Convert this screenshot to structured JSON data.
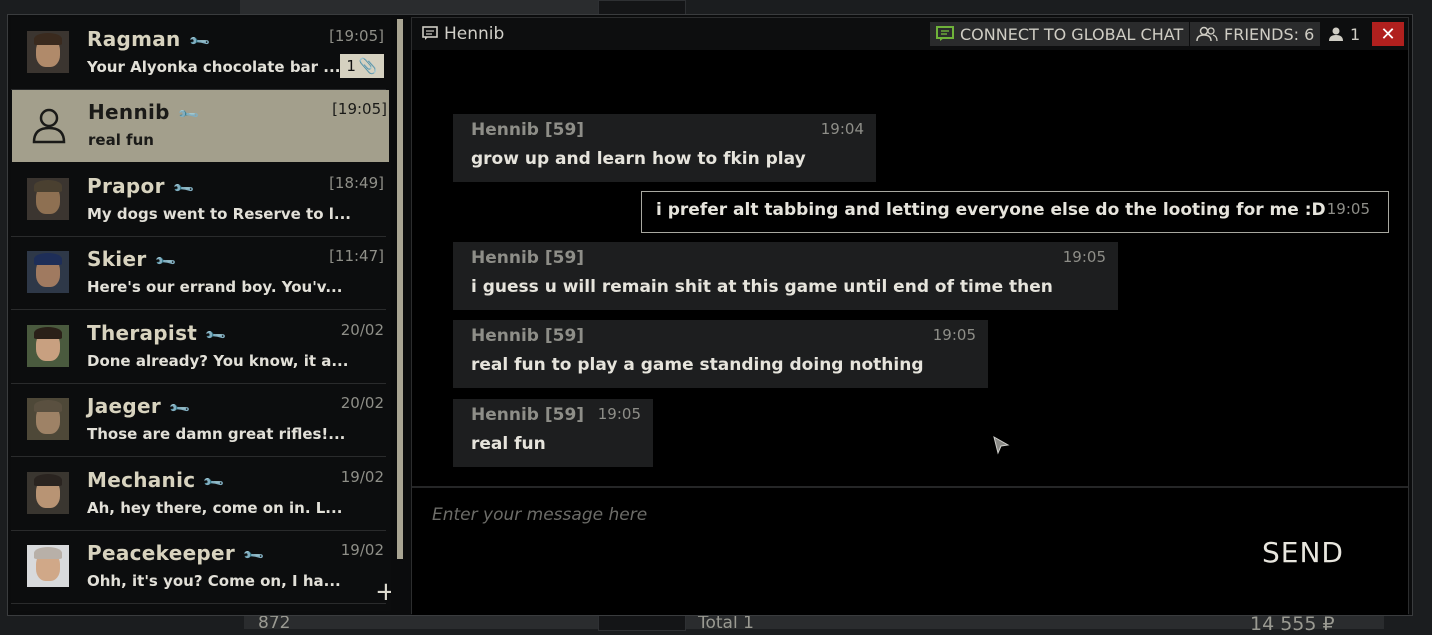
{
  "background": {
    "bottom_left_number": "872",
    "bottom_center_text": "Total 1",
    "bottom_right_number": "14 555 ₽"
  },
  "contacts": [
    {
      "name": "Ragman",
      "time": "[19:05]",
      "preview": "Your Alyonka chocolate bar  ...",
      "badge": "1",
      "active": false
    },
    {
      "name": "Hennib",
      "time": "[19:05]",
      "preview": "real fun",
      "active": true
    },
    {
      "name": "Prapor",
      "time": "[18:49]",
      "preview": "My dogs went to Reserve to l...",
      "active": false
    },
    {
      "name": "Skier",
      "time": "[11:47]",
      "preview": "Here's our errand boy. You'v...",
      "active": false
    },
    {
      "name": "Therapist",
      "time": "20/02",
      "preview": "Done already? You know, it a...",
      "active": false
    },
    {
      "name": "Jaeger",
      "time": "20/02",
      "preview": "Those are damn great rifles!...",
      "active": false
    },
    {
      "name": "Mechanic",
      "time": "19/02",
      "preview": "Ah, hey there, come on in. L...",
      "active": false
    },
    {
      "name": "Peacekeeper",
      "time": "19/02",
      "preview": "Ohh, it's you? Come on, I ha...",
      "active": false
    }
  ],
  "add_label": "+",
  "chat": {
    "title": "Hennib",
    "global_chat_label": "CONNECT TO GLOBAL CHAT",
    "friends_label": "FRIENDS: 6",
    "online_count": "1",
    "close_label": "✕",
    "messages": [
      {
        "author": "Hennib [59]",
        "time": "19:04",
        "text": "grow up and learn how to fkin play",
        "self": false
      },
      {
        "author": "",
        "time": "19:05",
        "text": "i prefer alt tabbing and letting everyone else do the looting for me :D",
        "self": true
      },
      {
        "author": "Hennib [59]",
        "time": "19:05",
        "text": "i guess u will remain shit at this game until end of time then",
        "self": false
      },
      {
        "author": "Hennib [59]",
        "time": "19:05",
        "text": "real fun to play a game standing doing nothing",
        "self": false
      },
      {
        "author": "Hennib [59]",
        "time": "19:05",
        "text": "real fun",
        "self": false
      }
    ],
    "input_placeholder": "Enter your message here",
    "send_label": "SEND"
  },
  "colors": {
    "active_contact": "#a39f8c",
    "global_chat_icon": "#6fb23a",
    "close_button": "#b0201e"
  }
}
